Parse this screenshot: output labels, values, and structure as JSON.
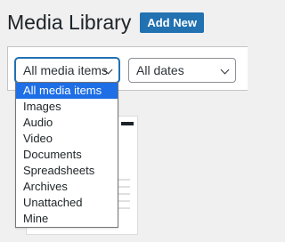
{
  "header": {
    "title": "Media Library",
    "add_new_label": "Add New"
  },
  "filters": {
    "type_select": {
      "value": "All media items",
      "options": [
        "All media items",
        "Images",
        "Audio",
        "Video",
        "Documents",
        "Spreadsheets",
        "Archives",
        "Unattached",
        "Mine"
      ],
      "selected_index": 0
    },
    "date_select": {
      "value": "All dates"
    }
  },
  "colors": {
    "accent": "#2271b1",
    "highlight": "#1e6ee6",
    "background": "#f0f0f1"
  },
  "icons": {
    "dropdown_arrow": "chevron-down-icon"
  }
}
